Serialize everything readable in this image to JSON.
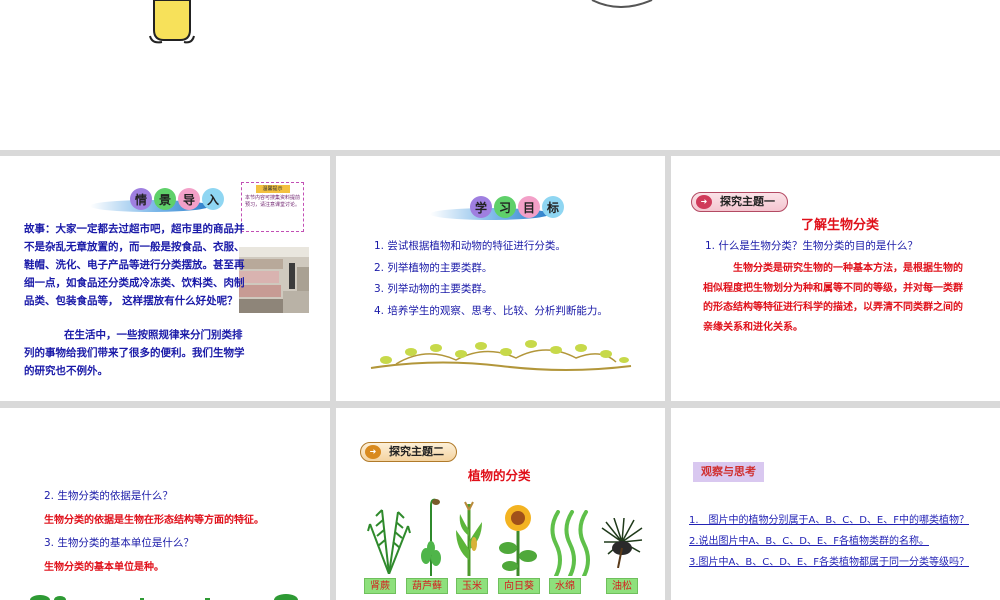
{
  "slide1": {
    "title_chars": [
      "情",
      "景",
      "导",
      "入"
    ],
    "notice_title": "温馨提示",
    "notice_text": "本节内容可搜集资料提前预习，请注意课堂讨论。",
    "story": "故事：大家一定都去过超市吧，超市里的商品并不是杂乱无章放置的，而一般是按食品、衣服、鞋帽、洗化、电子产品等进行分类摆放。甚至再细一点，如食品还分类成冷冻类、饮料类、肉制品类、包装食品等， 这样摆放有什么好处呢？",
    "para2": "在生活中，一些按照规律来分门别类排列的事物给我们带来了很多的便利。我们生物学的研究也不例外。"
  },
  "slide2": {
    "title_chars": [
      "学",
      "习",
      "目",
      "标"
    ],
    "goals": [
      "1. 尝试根据植物和动物的特征进行分类。",
      "2. 列举植物的主要类群。",
      "3. 列举动物的主要类群。",
      "4. 培养学生的观察、思考、比较、分析判断能力。"
    ]
  },
  "slide3": {
    "tag": "探究主题一",
    "heading": "了解生物分类",
    "question": "1. 什么是生物分类？生物分类的目的是什么？",
    "answer": "生物分类是研究生物的一种基本方法，是根据生物的相似程度把生物划分为种和属等不同的等级，并对每一类群的形态结构等特征进行科学的描述，以弄清不同类群之间的亲缘关系和进化关系。"
  },
  "slide4": {
    "q2": "2. 生物分类的依据是什么？",
    "a2": "生物分类的依据是生物在形态结构等方面的特征。",
    "q3": "3. 生物分类的基本单位是什么？",
    "a3": "生物分类的基本单位是种。"
  },
  "slide5": {
    "tag": "探究主题二",
    "heading": "植物的分类",
    "plants": [
      "肾蕨",
      "葫芦藓",
      "玉米",
      "向日葵",
      "水绵",
      "油松"
    ]
  },
  "slide6": {
    "tag": "观察与思考",
    "questions": [
      "1.　图片中的植物分别属于A、B、C、D、E、F中的哪类植物？",
      "2.说出图片中A、B、C、D、E、F各植物类群的名称。",
      "3.图片中A、B、C、D、E、F各类植物都属于同一分类等级吗？"
    ]
  },
  "colors": {
    "blue_text": "#1a1aa8",
    "red_text": "#e0101a",
    "background": "#d9d9d9"
  }
}
